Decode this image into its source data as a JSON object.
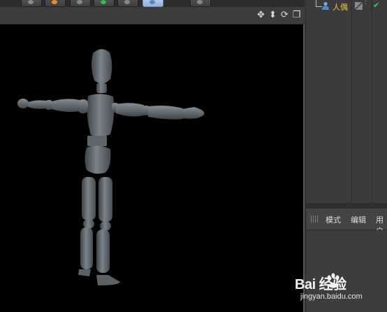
{
  "toolbar": {
    "buttons": [
      {
        "name": "toolbar-button-1",
        "active": false
      },
      {
        "name": "toolbar-button-2",
        "active": false
      },
      {
        "name": "toolbar-button-3",
        "active": false
      },
      {
        "name": "toolbar-button-4",
        "active": false
      },
      {
        "name": "toolbar-button-5",
        "active": false
      },
      {
        "name": "toolbar-button-6",
        "active": true
      },
      {
        "name": "toolbar-button-7",
        "active": false
      }
    ]
  },
  "viewport": {
    "background": "#000000",
    "nav_icons": [
      "move-icon",
      "zoom-icon",
      "rotate-icon",
      "maximize-icon"
    ],
    "figure_color": "#6a7278"
  },
  "objects": {
    "items": [
      {
        "name": "人偶",
        "icon": "person-icon",
        "visible": true
      }
    ]
  },
  "attributes": {
    "tabs": [
      "模式",
      "编辑",
      "用户"
    ]
  },
  "watermark": {
    "brand": "Bai  经验",
    "sub": "jingyan.baidu.com"
  },
  "colors": {
    "accent_name": "#f0c23a",
    "check_green": "#37d16a",
    "active_button": "#a9c6ea"
  }
}
